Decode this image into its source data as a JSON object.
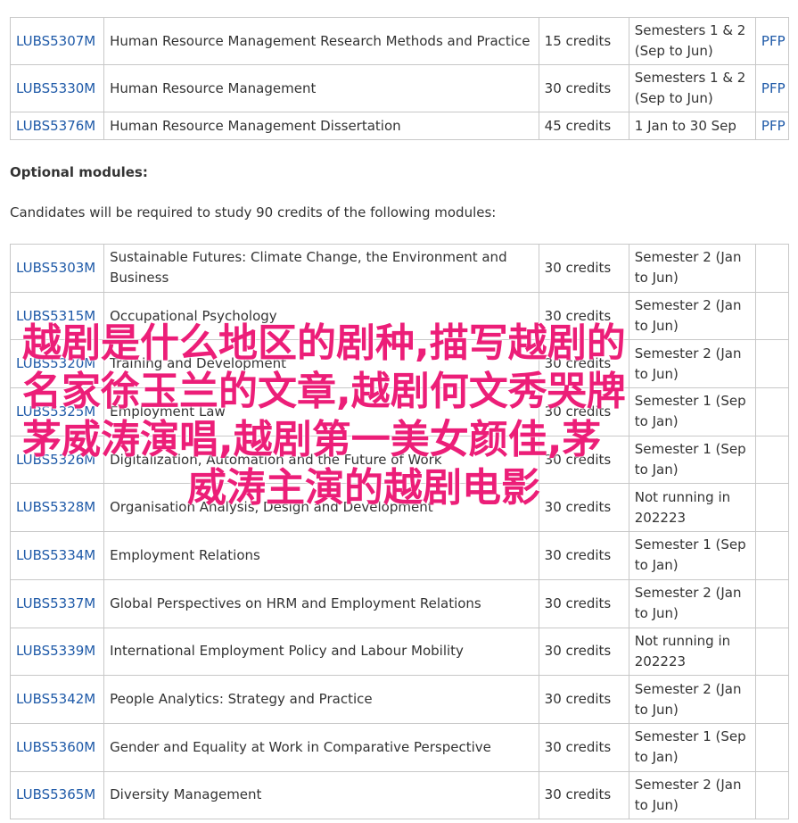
{
  "core_modules": [
    {
      "code": "LUBS5307M",
      "title": "Human Resource Management Research Methods and Practice",
      "credits": "15 credits",
      "semester": "Semesters 1 & 2 (Sep to Jun)",
      "type": "PFP"
    },
    {
      "code": "LUBS5330M",
      "title": "Human Resource Management",
      "credits": "30 credits",
      "semester": "Semesters 1 & 2 (Sep to Jun)",
      "type": "PFP"
    },
    {
      "code": "LUBS5376M",
      "title": "Human Resource Management Dissertation",
      "credits": "45 credits",
      "semester": "1 Jan to 30 Sep",
      "type": "PFP"
    }
  ],
  "optional": {
    "heading": "Optional modules:",
    "intro": "Candidates will be required to study 90 credits of the following modules:",
    "modules": [
      {
        "code": "LUBS5303M",
        "title": "Sustainable Futures: Climate Change, the Environment and Business",
        "credits": "30 credits",
        "semester": "Semester 2 (Jan to Jun)"
      },
      {
        "code": "LUBS5315M",
        "title": "Occupational Psychology",
        "credits": "30 credits",
        "semester": "Semester 2 (Jan to Jun)"
      },
      {
        "code": "LUBS5320M",
        "title": "Training and Development",
        "credits": "30 credits",
        "semester": "Semester 2 (Jan to Jun)"
      },
      {
        "code": "LUBS5325M",
        "title": "Employment Law",
        "credits": "30 credits",
        "semester": "Semester 1 (Sep to Jan)"
      },
      {
        "code": "LUBS5326M",
        "title": "Digitalization, Automation and the Future of Work",
        "credits": "30 credits",
        "semester": "Semester 1 (Sep to Jan)"
      },
      {
        "code": "LUBS5328M",
        "title": "Organisation Analysis, Design and Development",
        "credits": "30 credits",
        "semester": "Not running in 202223"
      },
      {
        "code": "LUBS5334M",
        "title": "Employment Relations",
        "credits": "30 credits",
        "semester": "Semester 1 (Sep to Jan)"
      },
      {
        "code": "LUBS5337M",
        "title": "Global Perspectives on HRM and Employment Relations",
        "credits": "30 credits",
        "semester": "Semester 2 (Jan to Jun)"
      },
      {
        "code": "LUBS5339M",
        "title": "International Employment Policy and Labour Mobility",
        "credits": "30 credits",
        "semester": "Not running in 202223"
      },
      {
        "code": "LUBS5342M",
        "title": "People Analytics: Strategy and Practice",
        "credits": "30 credits",
        "semester": "Semester 2 (Jan to Jun)"
      },
      {
        "code": "LUBS5360M",
        "title": "Gender and Equality at Work in Comparative Perspective",
        "credits": "30 credits",
        "semester": "Semester 1 (Sep to Jan)"
      },
      {
        "code": "LUBS5365M",
        "title": "Diversity Management",
        "credits": "30 credits",
        "semester": "Semester 2 (Jan to Jun)"
      }
    ]
  },
  "overlay": {
    "line1": "越剧是什么地区的剧种,描写越剧的",
    "line2": "名家徐玉兰的文章,越剧何文秀哭牌",
    "line3": "茅威涛演唱,越剧第一美女颜佳,茅",
    "line4": "威涛主演的越剧电影"
  },
  "colors": {
    "link": "#1f5aa8",
    "overlay_text": "#ec1e78",
    "border": "#c8c8c8"
  }
}
